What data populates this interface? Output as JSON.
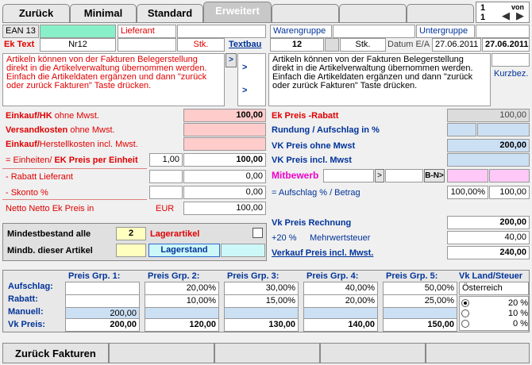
{
  "tabs": [
    "Zurück",
    "Minimal",
    "Standard",
    "Erweitert"
  ],
  "page": {
    "cur": "1",
    "total": "1",
    "von": "von"
  },
  "top": {
    "ean_label": "EAN 13",
    "lieferant_label": "Lieferant",
    "warengruppe_label": "Warengruppe",
    "untergruppe_label": "Untergruppe",
    "ektext_label": "Ek Text",
    "nr": "Nr12",
    "stk": "Stk.",
    "textbau": "Textbau",
    "qty": "12",
    "stk2": "Stk.",
    "datum_label": "Datum E/A",
    "datum1": "27.06.2011",
    "datum2": "27.06.2011",
    "kurzbez": "Kurzbez.",
    "arrow": ">"
  },
  "text_left": "Artikeln können von der Fakturen Belegerstellung direkt in die Artikelverwaltung übernommen werden. Einfach die Artikeldaten ergänzen und dann \"zurück oder zurück Fakturen\" Taste drücken.",
  "text_right": "Artikeln können von der Fakturen Belegerstellung direkt in die Artikelverwaltung übernommen werden. Einfach die Artikeldaten ergänzen und dann \"zurück oder zurück Fakturen\" Taste drücken.",
  "left": {
    "einkauf_b": "Einkauf/HK",
    "einkauf_n": " ohne Mwst.",
    "einkauf_v": "100,00",
    "versand_b": "Versandkosten",
    "versand_n": " ohne Mwst.",
    "herst_b": "Einkauf/",
    "herst_n": "Herstellkosten incl. Mwst.",
    "einheiten_a": "= Einheiten/ ",
    "einheiten_b": "EK Preis per Einheit",
    "einheiten_q": "1,00",
    "einheiten_v": "100,00",
    "rabatt": "- Rabatt Lieferant",
    "rabatt_v": "0,00",
    "skonto": "- Skonto %",
    "skonto_v": "0,00",
    "netto": "Netto Netto Ek Preis in",
    "eur": "EUR",
    "netto_v": "100,00"
  },
  "right": {
    "ekrabatt": "Ek Preis -Rabatt",
    "ekrabatt_v": "100,00",
    "rundung": "Rundung / Aufschlag in %",
    "vk_ohne": "VK Preis ohne Mwst",
    "vk_ohne_v": "200,00",
    "vk_incl": "VK Preis incl. Mwst",
    "mitbewerb": "Mitbewerb",
    "gt": ">",
    "bn": "B-N>",
    "aufschlag": "= Aufschlag % / Betrag",
    "aufschlag_p": "100,00%",
    "aufschlag_v": "100,00",
    "rechnung": "Vk Preis Rechnung",
    "rechnung_v": "200,00",
    "mwst_p": "+20 %",
    "mwst_l": "Mehrwertsteuer",
    "mwst_v": "40,00",
    "verkauf": "Verkauf Preis incl. Mwst.",
    "verkauf_v": "240,00"
  },
  "stock": {
    "mind_alle": "Mindestbestand alle",
    "mind_v": "2",
    "lager": "Lagerartikel",
    "mind_art": "Mindb. dieser Artikel",
    "lagerstand": "Lagerstand"
  },
  "grid": {
    "labels": [
      "Aufschlag:",
      "Rabatt:",
      "Manuell:",
      "Vk Preis:"
    ],
    "cols": [
      {
        "h": "Preis Grp. 1:",
        "a": "",
        "r": "",
        "m": "200,00",
        "v": "200,00"
      },
      {
        "h": "Preis Grp. 2:",
        "a": "20,00%",
        "r": "10,00%",
        "m": "",
        "v": "120,00"
      },
      {
        "h": "Preis Grp. 3:",
        "a": "30,00%",
        "r": "15,00%",
        "m": "",
        "v": "130,00"
      },
      {
        "h": "Preis Grp. 4:",
        "a": "40,00%",
        "r": "20,00%",
        "m": "",
        "v": "140,00"
      },
      {
        "h": "Preis Grp. 5:",
        "a": "50,00%",
        "r": "25,00%",
        "m": "",
        "v": "150,00"
      }
    ],
    "land_h": "Vk Land/Steuer",
    "land": "Österreich",
    "taxes": [
      "20 %",
      "10 %",
      "0 %"
    ]
  },
  "bottom": {
    "zurueck": "Zurück Fakturen"
  }
}
